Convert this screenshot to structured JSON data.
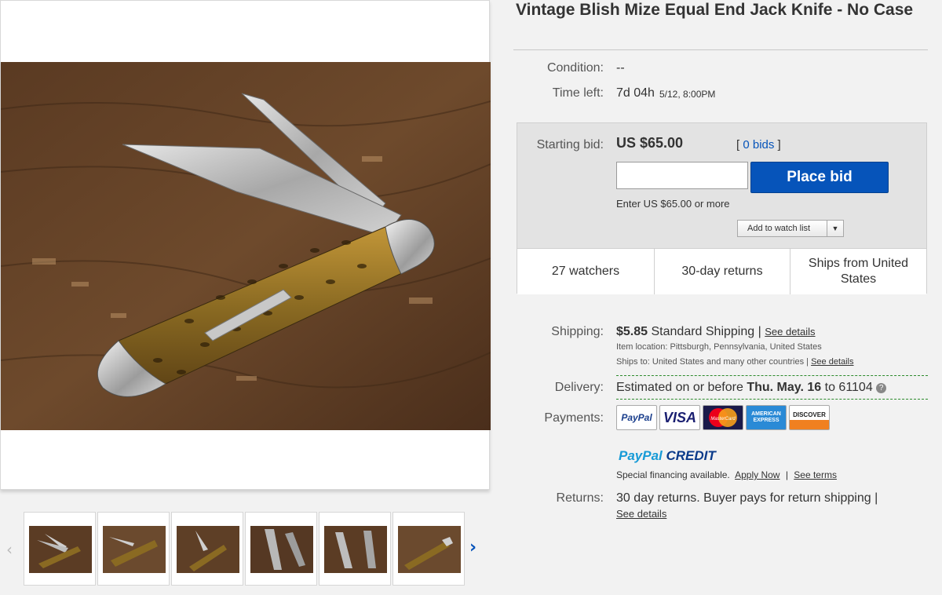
{
  "listing": {
    "title": "Vintage Blish Mize Equal End Jack Knife - No Case",
    "condition_label": "Condition:",
    "condition_value": "--",
    "time_left_label": "Time left:",
    "time_left_value": "7d 04h",
    "end_time": "5/12, 8:00PM"
  },
  "bid": {
    "starting_bid_label": "Starting bid:",
    "starting_bid_value": "US $65.00",
    "bids_open": "[",
    "bids_link": "0 bids",
    "bids_close": "]",
    "input_value": "",
    "place_bid_label": "Place bid",
    "hint": "Enter US $65.00 or more",
    "watch_label": "Add to watch list",
    "watch_dropdown_icon": "triangle-down"
  },
  "stats": [
    {
      "label": "27 watchers"
    },
    {
      "label": "30-day returns"
    },
    {
      "label": "Ships from United States"
    }
  ],
  "shipping": {
    "label": "Shipping:",
    "cost": "$5.85",
    "method": "Standard Shipping |",
    "see_details": "See details",
    "location_label": "Item location:",
    "location_value": "Pittsburgh, Pennsylvania, United States",
    "ships_to_label": "Ships to:",
    "ships_to_value": "United States and many other countries |",
    "ships_to_link": "See details"
  },
  "delivery": {
    "label": "Delivery:",
    "text": "Estimated on or before",
    "date": "Thu. May. 16",
    "to_text": "to 61104",
    "help_icon": "question-circle"
  },
  "payments": {
    "label": "Payments:",
    "logos": [
      "PayPal",
      "VISA",
      "MasterCard",
      "AMERICAN EXPRESS",
      "DISCOVER"
    ],
    "paypal_credit_pay": "PayPal",
    "paypal_credit_word": "CREDIT",
    "financing_text": "Special financing available.",
    "apply_now": "Apply Now",
    "separator": "|",
    "see_terms": "See terms"
  },
  "returns": {
    "label": "Returns:",
    "text": "30 day returns. Buyer pays for return shipping |",
    "see_details": "See details"
  },
  "gallery": {
    "prev_icon": "‹",
    "next_icon": "›",
    "thumbnail_count": 6
  },
  "colors": {
    "accent_blue": "#0654ba",
    "link_blue": "#0654ba",
    "dashed_green": "#2b8a2b",
    "bid_box_bg": "#e3e3e3"
  }
}
